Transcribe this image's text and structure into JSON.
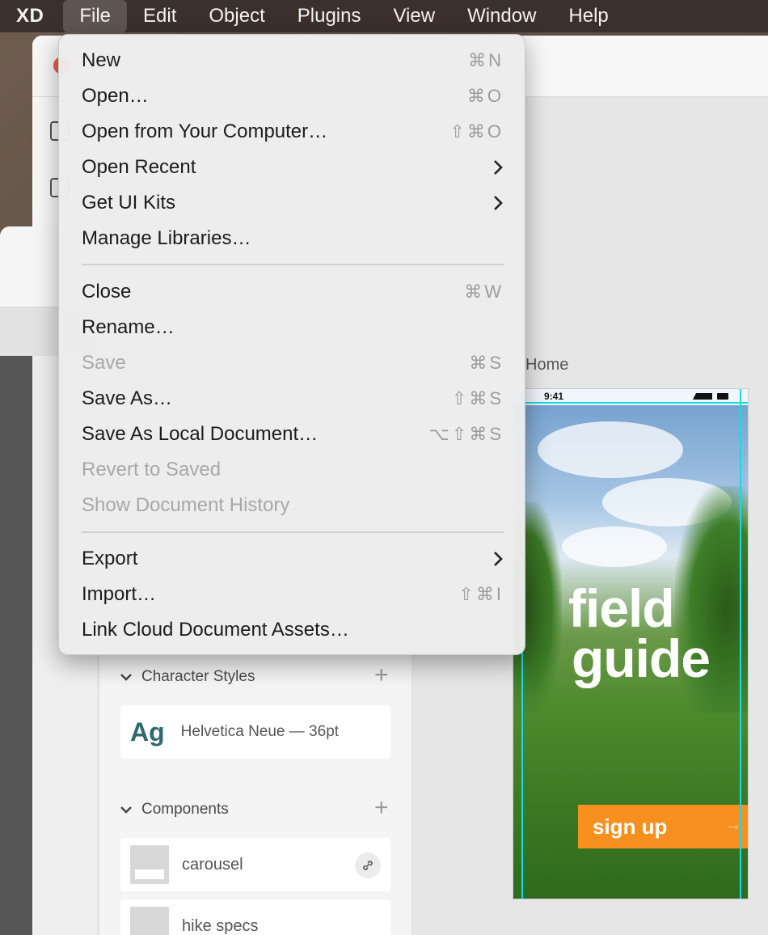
{
  "menubar": {
    "app_name": "XD",
    "items": [
      "File",
      "Edit",
      "Object",
      "Plugins",
      "View",
      "Window",
      "Help"
    ],
    "active": "File"
  },
  "file_menu": {
    "items": [
      {
        "label": "New",
        "shortcut": "⌘N",
        "submenu": false,
        "disabled": false
      },
      {
        "label": "Open…",
        "shortcut": "⌘O",
        "submenu": false,
        "disabled": false
      },
      {
        "label": "Open from Your Computer…",
        "shortcut": "⇧⌘O",
        "submenu": false,
        "disabled": false
      },
      {
        "label": "Open Recent",
        "shortcut": "",
        "submenu": true,
        "disabled": false
      },
      {
        "label": "Get UI Kits",
        "shortcut": "",
        "submenu": true,
        "disabled": false
      },
      {
        "label": "Manage Libraries…",
        "shortcut": "",
        "submenu": false,
        "disabled": false
      },
      {
        "label": "Close",
        "shortcut": "⌘W",
        "submenu": false,
        "disabled": false
      },
      {
        "label": "Rename…",
        "shortcut": "",
        "submenu": false,
        "disabled": false
      },
      {
        "label": "Save",
        "shortcut": "⌘S",
        "submenu": false,
        "disabled": true
      },
      {
        "label": "Save As…",
        "shortcut": "⇧⌘S",
        "submenu": false,
        "disabled": false
      },
      {
        "label": "Save As Local Document…",
        "shortcut": "⌥⇧⌘S",
        "submenu": false,
        "disabled": false
      },
      {
        "label": "Revert to Saved",
        "shortcut": "",
        "submenu": false,
        "disabled": true
      },
      {
        "label": "Show Document History",
        "shortcut": "",
        "submenu": false,
        "disabled": true
      },
      {
        "label": "Export",
        "shortcut": "",
        "submenu": true,
        "disabled": false
      },
      {
        "label": "Import…",
        "shortcut": "⇧⌘I",
        "submenu": false,
        "disabled": false
      },
      {
        "label": "Link Cloud Document Assets…",
        "shortcut": "",
        "submenu": false,
        "disabled": false
      }
    ]
  },
  "assets_panel": {
    "character_styles_title": "Character Styles",
    "char_style_sample": "Ag",
    "char_style_meta": "Helvetica Neue — 36pt",
    "components_title": "Components",
    "components": [
      "carousel",
      "hike specs"
    ]
  },
  "artboard": {
    "label": "Home",
    "status_time": "9:41",
    "hero_line1": "field",
    "hero_line2": "guide",
    "cta": "sign up",
    "cta_arrow": "→"
  },
  "colors": {
    "cta": "#f7901e",
    "guides": "#1fd7e4",
    "menubar": "#3b302c",
    "char_style": "#2f6a6e"
  }
}
